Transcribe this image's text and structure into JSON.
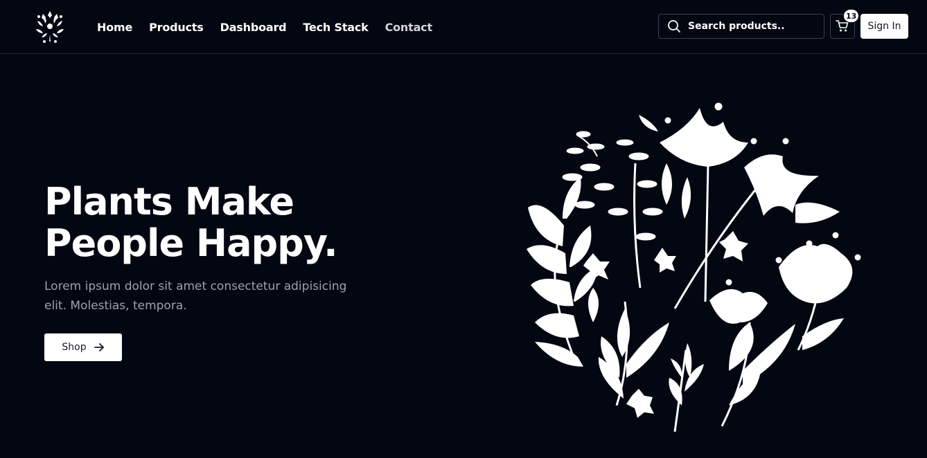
{
  "nav": {
    "links": [
      {
        "label": "Home"
      },
      {
        "label": "Products"
      },
      {
        "label": "Dashboard"
      },
      {
        "label": "Tech Stack"
      },
      {
        "label": "Contact"
      }
    ]
  },
  "search": {
    "placeholder": "Search products..",
    "icon": "search-icon"
  },
  "cart": {
    "count": "13",
    "icon": "cart-icon"
  },
  "auth": {
    "signin_label": "Sign In"
  },
  "hero": {
    "title_line1": "Plants Make",
    "title_line2": "People Happy.",
    "subtitle": "Lorem ipsum dolor sit amet consectetur adipisicing elit. Molestias, tempora.",
    "cta_label": "Shop",
    "cta_icon": "arrow-right-icon"
  },
  "colors": {
    "background": "#030712",
    "text": "#ffffff",
    "muted_text": "#9ca3af",
    "border": "#1f2937"
  }
}
